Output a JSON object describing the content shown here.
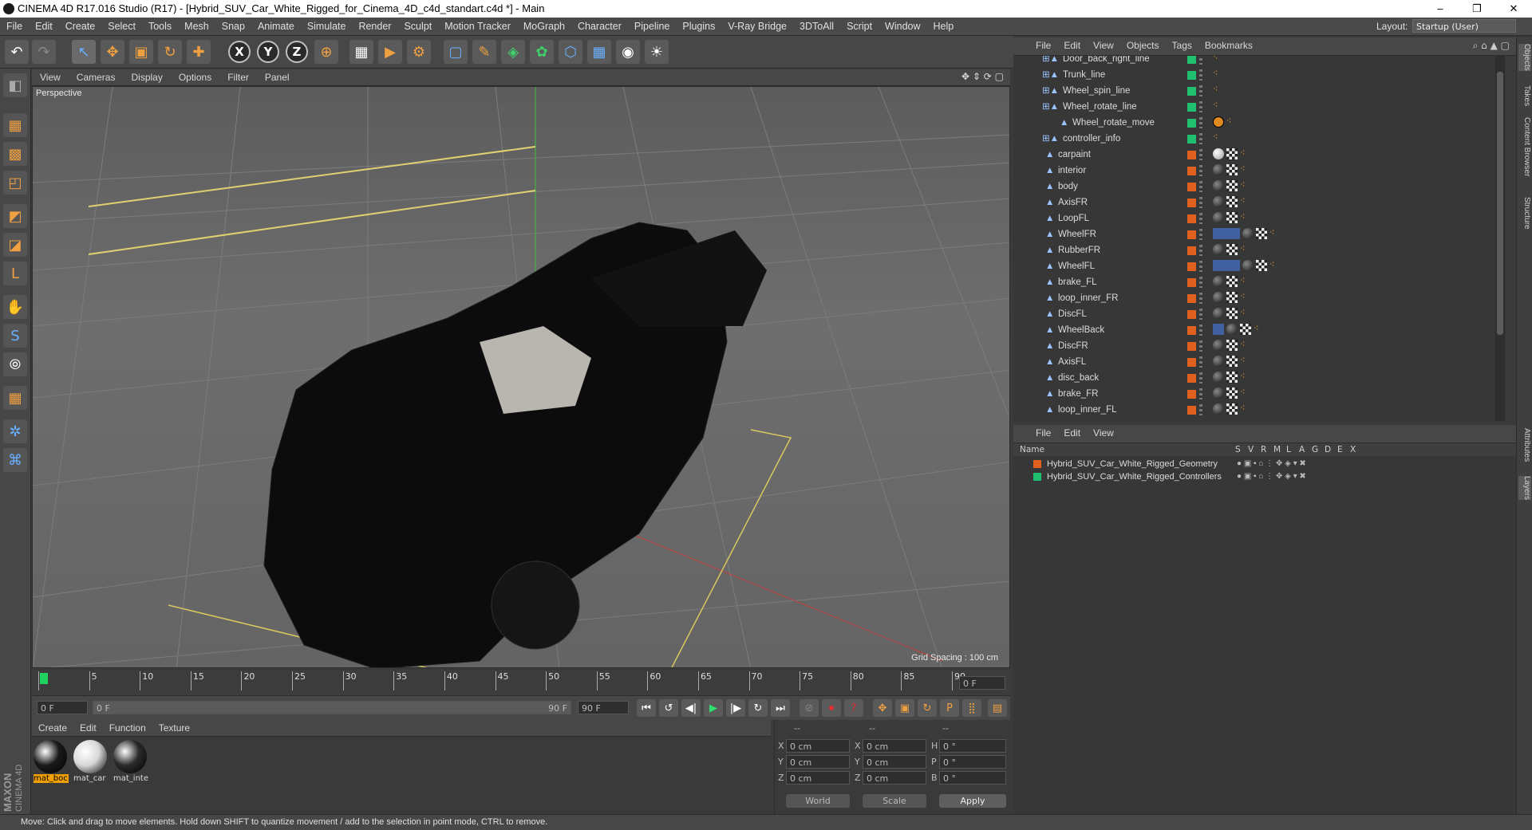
{
  "window": {
    "title": "CINEMA 4D R17.016 Studio (R17) - [Hybrid_SUV_Car_White_Rigged_for_Cinema_4D_c4d_standart.c4d *] - Main",
    "minimize": "–",
    "maximize": "❐",
    "close": "✕"
  },
  "menubar": [
    "File",
    "Edit",
    "Create",
    "Select",
    "Tools",
    "Mesh",
    "Snap",
    "Animate",
    "Simulate",
    "Render",
    "Sculpt",
    "Motion Tracker",
    "MoGraph",
    "Character",
    "Pipeline",
    "Plugins",
    "V-Ray Bridge",
    "3DToAll",
    "Script",
    "Window",
    "Help"
  ],
  "layout": {
    "label": "Layout:",
    "value": "Startup (User)"
  },
  "toolbar": {
    "undo": "↶",
    "redo": "↷",
    "select": "↖",
    "move": "✥",
    "scale": "▣",
    "rotate": "↻",
    "recent": "✚",
    "x": "X",
    "y": "Y",
    "z": "Z",
    "world": "⊕",
    "render_view": "▦",
    "render_pv": "▶",
    "render_settings": "⚙",
    "cube": "▢",
    "pen": "✎",
    "subdivide": "◈",
    "cloner": "✿",
    "deform": "⬡",
    "floor": "▦",
    "camera": "◉",
    "light": "☀"
  },
  "lefttools": [
    "◧",
    "▦",
    "▩",
    "◰",
    "◩",
    "◪",
    "L",
    "✋",
    "S",
    "⦾",
    "▦",
    "✲",
    "⌘"
  ],
  "viewport": {
    "menu": [
      "View",
      "Cameras",
      "Display",
      "Options",
      "Filter",
      "Panel"
    ],
    "label": "Perspective",
    "grid_spacing": "Grid Spacing : 100 cm",
    "nav_icons": "✥ ⇕ ⟳ ▢"
  },
  "timeline": {
    "ticks": [
      "0",
      "5",
      "10",
      "15",
      "20",
      "25",
      "30",
      "35",
      "40",
      "45",
      "50",
      "55",
      "60",
      "65",
      "70",
      "75",
      "80",
      "85",
      "90"
    ],
    "current_frame": "0 F"
  },
  "playbar": {
    "start": "0 F",
    "range_start": "0 F",
    "range_end": "90 F",
    "end": "90 F",
    "buttons": [
      "⏮",
      "↺",
      "◀|",
      "▶",
      "|▶",
      "↻",
      "⏭"
    ],
    "record_buttons": [
      "⊘",
      "⏺",
      "?",
      "✥",
      "▣",
      "↻",
      "P",
      "⣿",
      "▤"
    ]
  },
  "materials": {
    "menu": [
      "Create",
      "Edit",
      "Function",
      "Texture"
    ],
    "items": [
      {
        "name": "mat_boc",
        "color": "#1a1a1a"
      },
      {
        "name": "mat_car",
        "color": "#d8d8d8"
      },
      {
        "name": "mat_inte",
        "color": "#2a2a2a"
      }
    ],
    "brand_a": "MAXON",
    "brand_b": "CINEMA 4D"
  },
  "coords": {
    "headers": [
      "--",
      "--",
      "--"
    ],
    "rows": [
      {
        "l1": "X",
        "v1": "0 cm",
        "l2": "X",
        "v2": "0 cm",
        "l3": "H",
        "v3": "0 °"
      },
      {
        "l1": "Y",
        "v1": "0 cm",
        "l2": "Y",
        "v2": "0 cm",
        "l3": "P",
        "v3": "0 °"
      },
      {
        "l1": "Z",
        "v1": "0 cm",
        "l2": "Z",
        "v2": "0 cm",
        "l3": "B",
        "v3": "0 °"
      }
    ],
    "world": "World",
    "scale": "Scale",
    "apply": "Apply"
  },
  "status": "Move: Click and drag to move elements. Hold down SHIFT to quantize movement / add to the selection in point mode, CTRL to remove.",
  "objects": {
    "menu": [
      "File",
      "Edit",
      "View",
      "Objects",
      "Tags",
      "Bookmarks"
    ],
    "rows": [
      {
        "name": "Door_back_right_line",
        "indent": 1,
        "color": "#20c070",
        "tags": [
          "og"
        ]
      },
      {
        "name": "Trunk_line",
        "indent": 1,
        "color": "#20c070",
        "tags": [
          "og"
        ]
      },
      {
        "name": "Wheel_spin_line",
        "indent": 1,
        "color": "#20c070",
        "tags": [
          "og"
        ]
      },
      {
        "name": "Wheel_rotate_line",
        "indent": 1,
        "color": "#20c070",
        "tags": [
          "og"
        ]
      },
      {
        "name": "Wheel_rotate_move",
        "indent": 2,
        "color": "#20c070",
        "tags": [
          "no",
          "og"
        ]
      },
      {
        "name": "controller_info",
        "indent": 1,
        "color": "#20c070",
        "tags": [
          "og"
        ]
      },
      {
        "name": "carpaint",
        "indent": 0,
        "color": "#e06020",
        "tags": [
          "white",
          "chk",
          "og"
        ]
      },
      {
        "name": "interior",
        "indent": 0,
        "color": "#e06020",
        "tags": [
          "dark",
          "chk",
          "og"
        ]
      },
      {
        "name": "body",
        "indent": 0,
        "color": "#e06020",
        "tags": [
          "dark",
          "chk",
          "og"
        ]
      },
      {
        "name": "AxisFR",
        "indent": 0,
        "color": "#e06020",
        "tags": [
          "dark",
          "chk",
          "og"
        ]
      },
      {
        "name": "LoopFL",
        "indent": 0,
        "color": "#e06020",
        "tags": [
          "dark",
          "chk",
          "og"
        ]
      },
      {
        "name": "WheelFR",
        "indent": 0,
        "color": "#e06020",
        "tags": [
          "blue",
          "dark",
          "chk",
          "og"
        ]
      },
      {
        "name": "RubberFR",
        "indent": 0,
        "color": "#e06020",
        "tags": [
          "dark",
          "chk",
          "og"
        ]
      },
      {
        "name": "WheelFL",
        "indent": 0,
        "color": "#e06020",
        "tags": [
          "blue",
          "dark",
          "chk",
          "og"
        ]
      },
      {
        "name": "brake_FL",
        "indent": 0,
        "color": "#e06020",
        "tags": [
          "dark",
          "chk",
          "og"
        ]
      },
      {
        "name": "loop_inner_FR",
        "indent": 0,
        "color": "#e06020",
        "tags": [
          "dark",
          "chk",
          "og"
        ]
      },
      {
        "name": "DiscFL",
        "indent": 0,
        "color": "#e06020",
        "tags": [
          "dark",
          "chk",
          "og"
        ]
      },
      {
        "name": "WheelBack",
        "indent": 0,
        "color": "#e06020",
        "tags": [
          "bluesm",
          "dark",
          "chk",
          "og"
        ]
      },
      {
        "name": "DiscFR",
        "indent": 0,
        "color": "#e06020",
        "tags": [
          "dark",
          "chk",
          "og"
        ]
      },
      {
        "name": "AxisFL",
        "indent": 0,
        "color": "#e06020",
        "tags": [
          "dark",
          "chk",
          "og"
        ]
      },
      {
        "name": "disc_back",
        "indent": 0,
        "color": "#e06020",
        "tags": [
          "dark",
          "chk",
          "og"
        ]
      },
      {
        "name": "brake_FR",
        "indent": 0,
        "color": "#e06020",
        "tags": [
          "dark",
          "chk",
          "og"
        ]
      },
      {
        "name": "loop_inner_FL",
        "indent": 0,
        "color": "#e06020",
        "tags": [
          "dark",
          "chk",
          "og"
        ]
      }
    ]
  },
  "layers": {
    "menu": [
      "File",
      "Edit",
      "View"
    ],
    "header": {
      "name": "Name",
      "cols": [
        "S",
        "V",
        "R",
        "M",
        "L",
        "A",
        "G",
        "D",
        "E",
        "X"
      ]
    },
    "rows": [
      {
        "name": "Hybrid_SUV_Car_White_Rigged_Geometry",
        "color": "#e06020"
      },
      {
        "name": "Hybrid_SUV_Car_White_Rigged_Controllers",
        "color": "#20c070"
      }
    ]
  },
  "side_tabs": [
    "Objects",
    "Takes",
    "Content Browser",
    "Structure",
    "Attributes",
    "Layers"
  ]
}
